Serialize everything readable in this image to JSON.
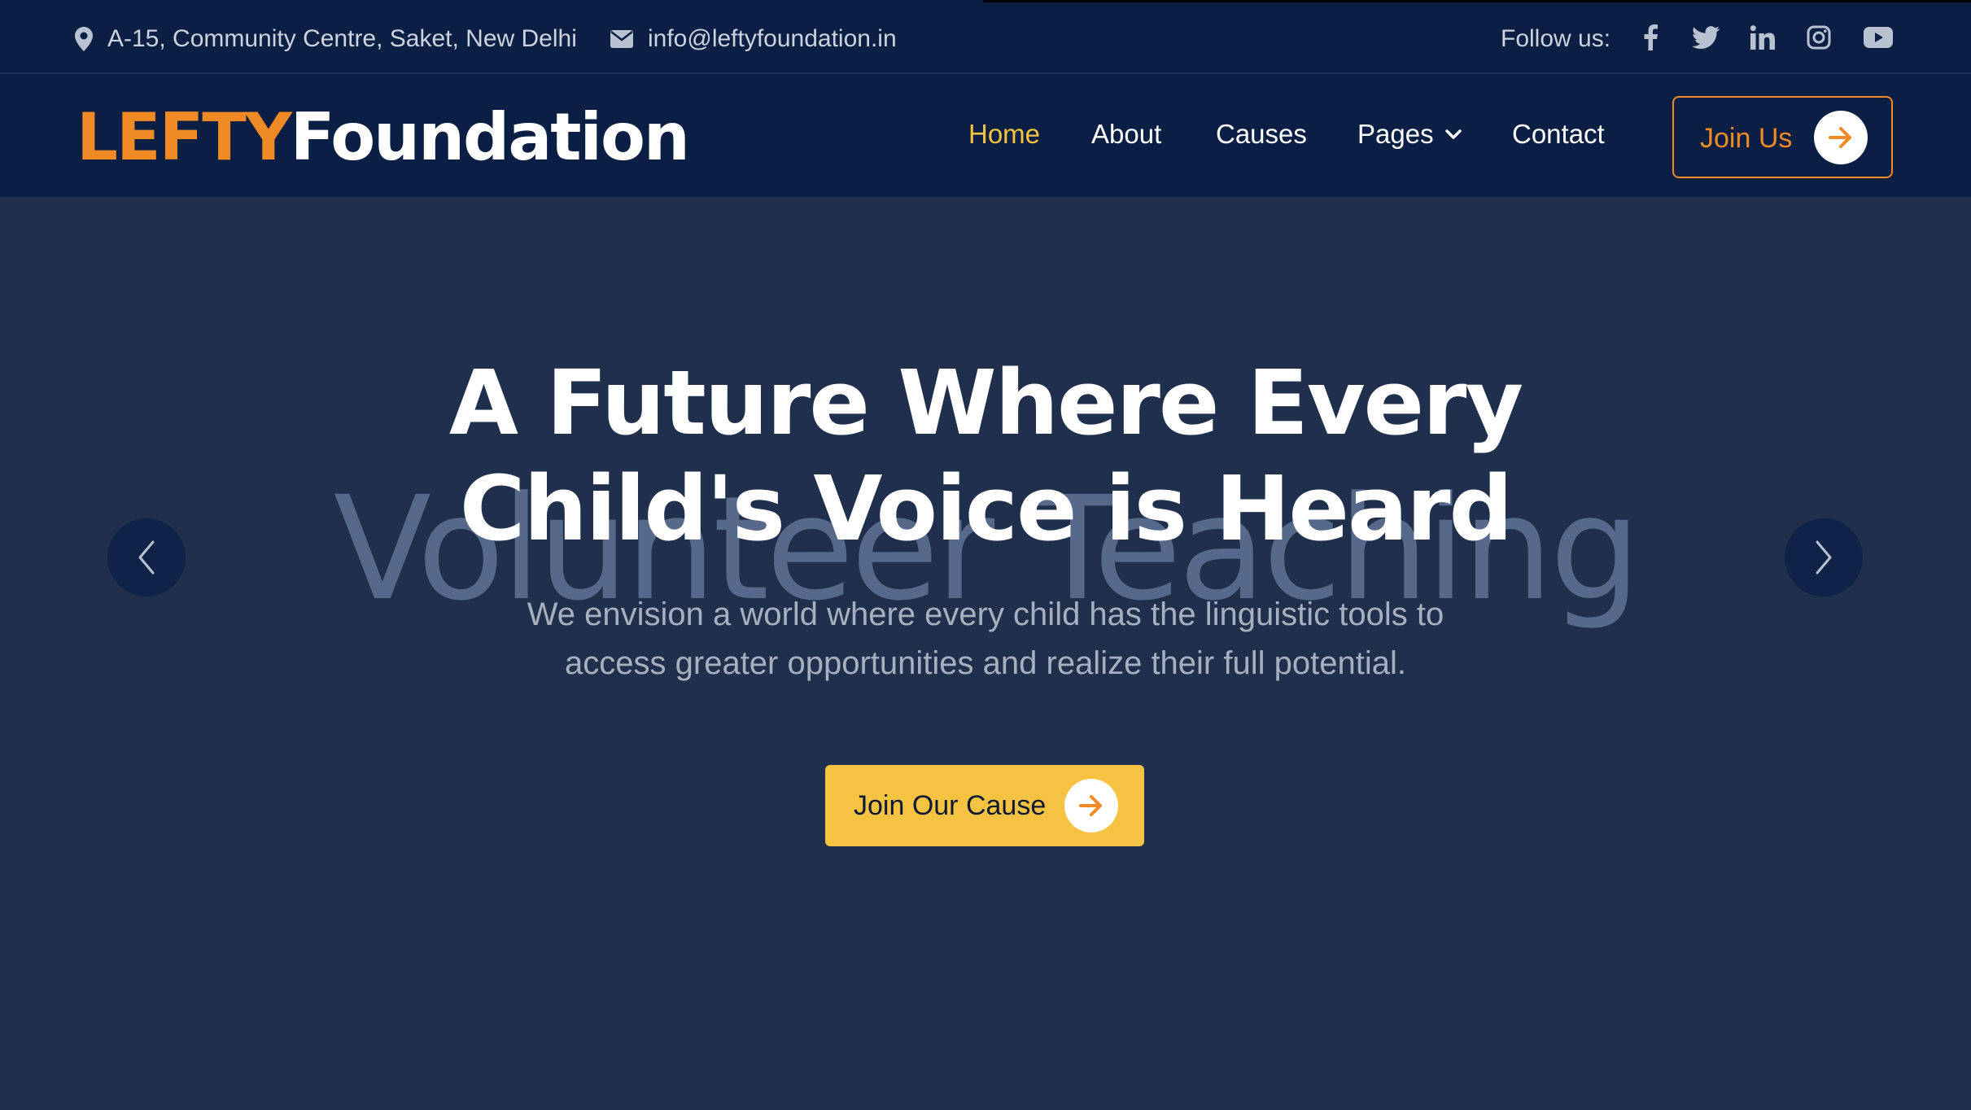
{
  "topbar": {
    "address": "A-15, Community Centre, Saket, New Delhi",
    "email": "info@leftyfoundation.in",
    "follow_label": "Follow us:",
    "social": [
      "facebook-icon",
      "twitter-icon",
      "linkedin-icon",
      "instagram-icon",
      "youtube-icon"
    ]
  },
  "brand": {
    "part1": "LEFTY",
    "part2": "Foundation"
  },
  "nav": {
    "items": [
      {
        "label": "Home",
        "active": true
      },
      {
        "label": "About"
      },
      {
        "label": "Causes"
      },
      {
        "label": "Pages"
      },
      {
        "label": "Contact"
      }
    ],
    "join_label": "Join Us"
  },
  "hero": {
    "watermark": "Volunteer Teaching",
    "headline_line1": "A Future Where Every",
    "headline_line2": "Child's Voice is Heard",
    "sub_line1": "We envision a world where every child has the linguistic tools to",
    "sub_line2": "access greater opportunities and realize their full potential.",
    "cta_label": "Join Our Cause"
  },
  "colors": {
    "navy": "#0b1f45",
    "hero_bg": "#20304c",
    "accent_orange": "#f08a24",
    "accent_yellow": "#f5c242",
    "white": "#ffffff"
  }
}
